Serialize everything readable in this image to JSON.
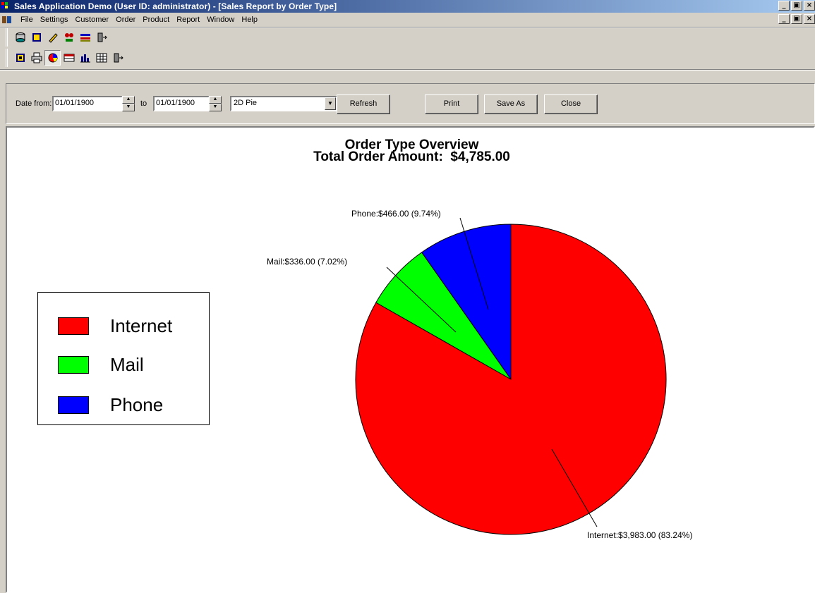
{
  "window": {
    "title": "Sales Application Demo (User ID: administrator) - [Sales Report by Order Type]",
    "controls": [
      "_",
      "×",
      "X"
    ]
  },
  "menu": {
    "items": [
      "File",
      "Settings",
      "Customer",
      "Order",
      "Product",
      "Report",
      "Window",
      "Help"
    ]
  },
  "toolbar1": {
    "icons": [
      "database-icon",
      "customer-icon",
      "edit-icon",
      "order-icon",
      "product-icon",
      "exit-icon"
    ]
  },
  "toolbar2": {
    "icons": [
      "report-icon",
      "print-icon",
      "pie-chart-icon",
      "grid-icon",
      "bar-chart-icon",
      "table-icon",
      "exit-icon"
    ]
  },
  "filter": {
    "date_from_label": "Date from:",
    "date_from": "01/01/1900",
    "to_label": "to",
    "date_to": "01/01/1900",
    "chart_type": "2D Pie",
    "refresh": "Refresh",
    "print": "Print",
    "save_as": "Save As",
    "close": "Close"
  },
  "chart_data": {
    "type": "pie",
    "title": "Order Type Overview",
    "subtitle": "Total Order Amount:  $4,785.00",
    "legend_position": "left",
    "slices": [
      {
        "name": "Internet",
        "value": 3983.0,
        "percent": 83.24,
        "label": "Internet:$3,983.00 (83.24%)",
        "color": "#ff0000"
      },
      {
        "name": "Mail",
        "value": 336.0,
        "percent": 7.02,
        "label": "Mail:$336.00 (7.02%)",
        "color": "#00ff00"
      },
      {
        "name": "Phone",
        "value": 466.0,
        "percent": 9.74,
        "label": "Phone:$466.00 (9.74%)",
        "color": "#0000ff"
      }
    ]
  }
}
